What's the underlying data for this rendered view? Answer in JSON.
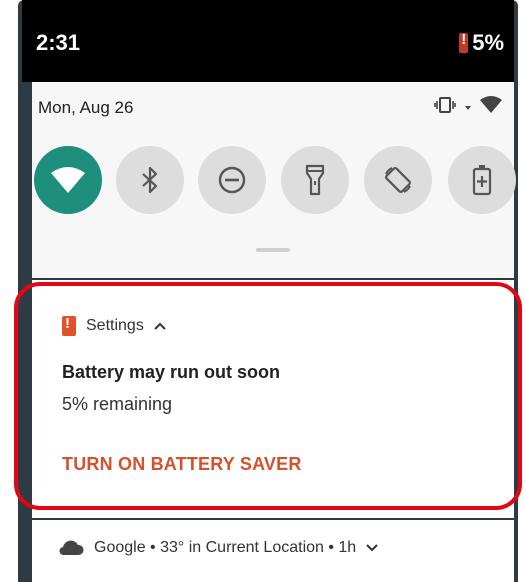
{
  "status_bar": {
    "time": "2:31",
    "battery_percent": "5%"
  },
  "quick_settings": {
    "date": "Mon, Aug 26",
    "tiles": [
      {
        "name": "wifi-icon",
        "active": true
      },
      {
        "name": "bluetooth-icon",
        "active": false
      },
      {
        "name": "do-not-disturb-icon",
        "active": false
      },
      {
        "name": "flashlight-icon",
        "active": false
      },
      {
        "name": "auto-rotate-icon",
        "active": false
      },
      {
        "name": "battery-saver-icon",
        "active": false
      }
    ]
  },
  "notification": {
    "app_name": "Settings",
    "title": "Battery may run out soon",
    "text": "5% remaining",
    "action_label": "TURN ON BATTERY SAVER"
  },
  "google_notification": {
    "text": "Google • 33° in Current Location • 1h"
  },
  "colors": {
    "accent": "#1f8f7d",
    "action": "#d5512b",
    "highlight": "#e30613"
  }
}
